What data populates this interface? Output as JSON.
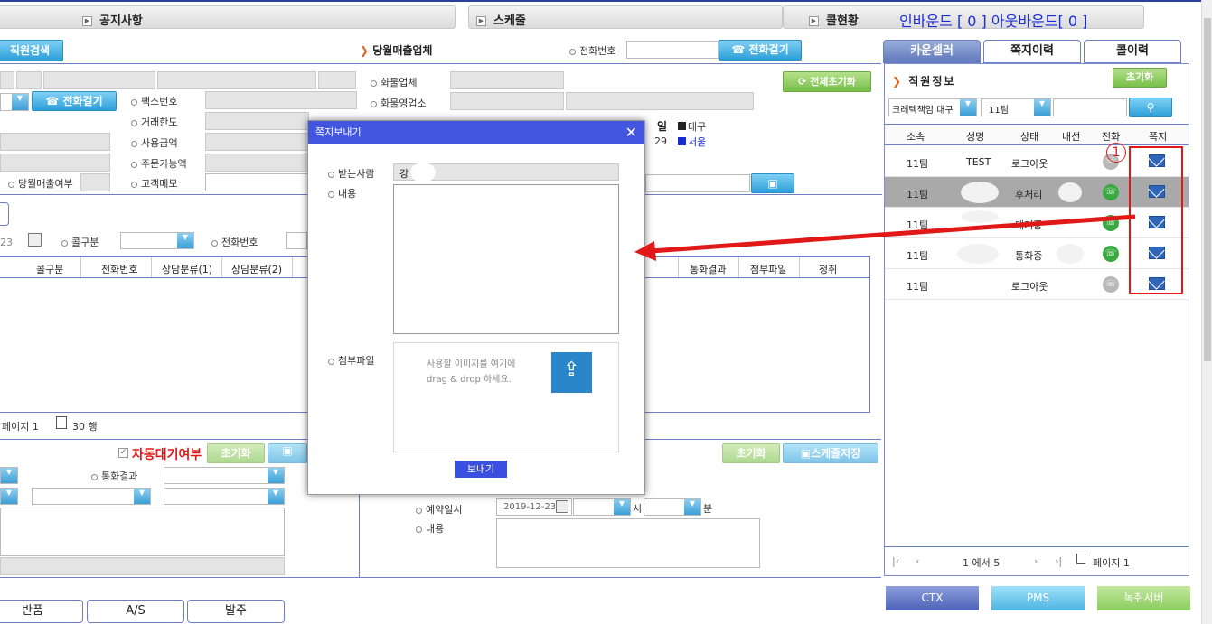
{
  "topbar": {
    "notice_label": "공지사항",
    "schedule_label": "스케줄",
    "call_status_label": "콜현황",
    "inbound_outbound": "인바운드 [ 0 ] 아웃바운드[ 0 ]"
  },
  "left": {
    "staff_search_btn": "직원검색",
    "call_btn_small": "전화걸기",
    "fax_label": "팩스번호",
    "credit_limit_label": "거래한도",
    "used_amount_label": "사용금액",
    "orderable_label": "주문가능액",
    "monthly_sales_flag_label": "당월매출여부",
    "customer_memo_label": "고객메모",
    "date_value": "23",
    "call_type_label": "콜구분",
    "phone_label": "전화번호",
    "columns": [
      "콜구분",
      "전화번호",
      "상담분류(1)",
      "상담분류(2)",
      "통화결과",
      "첨부파일",
      "청취"
    ],
    "page_label": "페이지 1",
    "rows_label": "30 행",
    "auto_wait_label": "자동대기여부",
    "reset_btn": "초기화",
    "call_result_label": "통화결과",
    "schedule_reset_btn": "초기화",
    "schedule_save_btn": "스케줄저장",
    "reservation_label": "예약일시",
    "reservation_date": "2019-12-23",
    "hour_label": "시",
    "minute_label": "분",
    "content_label": "내용"
  },
  "center": {
    "monthly_sales_company": "당월매출업체",
    "phone_label": "전화번호",
    "call_btn": "전화걸기",
    "cargo_company_label": "화물업체",
    "cargo_sales_label": "화물영업소",
    "reset_all_btn": "전체초기화",
    "day_label": "일",
    "region_daegu": "대구",
    "day_value": "29",
    "region_seoul": "서울"
  },
  "right": {
    "tabs": [
      "카운셀러",
      "쪽지이력",
      "콜이력"
    ],
    "section_title": "직원정보",
    "reset_btn": "초기화",
    "filter_org": "크레텍책임 대구",
    "filter_team": "11팀",
    "columns": [
      "소속",
      "성명",
      "상태",
      "내선",
      "전화",
      "쪽지"
    ],
    "rows": [
      {
        "team": "11팀",
        "name": "TEST",
        "status": "로그아웃",
        "ext": ""
      },
      {
        "team": "11팀",
        "name": "",
        "status": "후처리",
        "ext": ""
      },
      {
        "team": "11팀",
        "name": "",
        "status": "대기중",
        "ext": ""
      },
      {
        "team": "11팀",
        "name": "",
        "status": "통화중",
        "ext": ""
      },
      {
        "team": "11팀",
        "name": "",
        "status": "로그아웃",
        "ext": ""
      }
    ],
    "pager_text": "1 에서 5",
    "page_label": "페이지 1",
    "annotation": "1"
  },
  "modal": {
    "title": "쪽지보내기",
    "recipient_label": "받는사람",
    "recipient_value": "강",
    "content_label": "내용",
    "attach_label": "첨부파일",
    "drop_hint_line1": "사용할 이미지를 여기에",
    "drop_hint_line2": "drag & drop 하세요.",
    "send_btn": "보내기"
  },
  "bottom": {
    "return_btn": "반품",
    "as_btn": "A/S",
    "order_btn": "발주",
    "ctx_btn": "CTX",
    "pms_btn": "PMS",
    "record_btn": "녹취서버"
  }
}
